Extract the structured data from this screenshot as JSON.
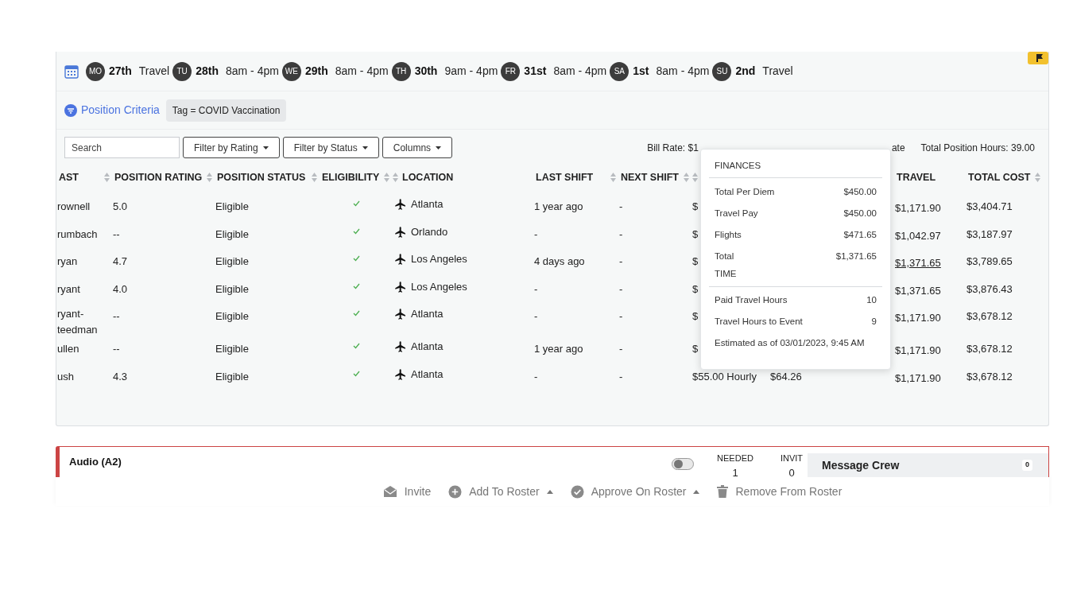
{
  "schedule": [
    {
      "day": "MO",
      "date": "27th",
      "hours": "Travel"
    },
    {
      "day": "TU",
      "date": "28th",
      "hours": "8am - 4pm"
    },
    {
      "day": "WE",
      "date": "29th",
      "hours": "8am - 4pm"
    },
    {
      "day": "TH",
      "date": "30th",
      "hours": "9am - 4pm"
    },
    {
      "day": "FR",
      "date": "31st",
      "hours": "8am - 4pm"
    },
    {
      "day": "SA",
      "date": "1st",
      "hours": "8am - 4pm"
    },
    {
      "day": "SU",
      "date": "2nd",
      "hours": "Travel"
    }
  ],
  "criteria": {
    "label": "Position Criteria",
    "tags": [
      "Tag = COVID Vaccination"
    ]
  },
  "toolbar": {
    "search_placeholder": "Search",
    "filters": [
      "Filter by Rating",
      "Filter by Status",
      "Columns"
    ],
    "bill_rate_start": "Bill Rate: $1",
    "bill_rate_end": "ate",
    "total_hours": "Total Position Hours: 39.00"
  },
  "table": {
    "columns": [
      {
        "label": "AST",
        "sortable": true
      },
      {
        "label": "POSITION RATING",
        "sortable": true
      },
      {
        "label": "POSITION STATUS",
        "sortable": true
      },
      {
        "label": "ELIGIBILITY",
        "sortable": true
      },
      {
        "label": "LOCATION",
        "sortable": true
      },
      {
        "label": "LAST SHIFT",
        "sortable": true
      },
      {
        "label": "NEXT SHIFT",
        "sortable": true
      },
      {
        "sortable": true
      },
      {
        "label": "TRAVEL",
        "sortable": false
      },
      {
        "label": "TOTAL COST",
        "sortable": true
      }
    ],
    "rows": [
      {
        "name": "rownell",
        "rating": "5.0",
        "status": "Eligible",
        "eligible": true,
        "location": "Atlanta",
        "last_shift": "1 year ago",
        "next_shift": "-",
        "column_8": "$",
        "travel": "$1,171.90",
        "travel_link": false,
        "total_cost": "$3,404.71"
      },
      {
        "name": "rumbach",
        "rating": "--",
        "status": "Eligible",
        "eligible": true,
        "location": "Orlando",
        "last_shift": "-",
        "next_shift": "-",
        "column_8": "$",
        "travel": "$1,042.97",
        "travel_link": false,
        "total_cost": "$3,187.97"
      },
      {
        "name": "ryan",
        "rating": "4.7",
        "status": "Eligible",
        "eligible": true,
        "location": "Los Angeles",
        "last_shift": "4 days ago",
        "next_shift": "-",
        "column_8": "$",
        "travel": "$1,371.65",
        "travel_link": true,
        "total_cost": "$3,789.65"
      },
      {
        "name": "ryant",
        "rating": "4.0",
        "status": "Eligible",
        "eligible": true,
        "location": "Los Angeles",
        "last_shift": "-",
        "next_shift": "-",
        "column_8": "$",
        "travel": "$1,371.65",
        "travel_link": false,
        "total_cost": "$3,876.43"
      },
      {
        "name": "ryant-teedman",
        "rating": "--",
        "status": "Eligible",
        "eligible": true,
        "location": "Atlanta",
        "last_shift": "-",
        "next_shift": "-",
        "column_8": "$",
        "travel": "$1,171.90",
        "travel_link": false,
        "total_cost": "$3,678.12"
      },
      {
        "name": "ullen",
        "rating": "--",
        "status": "Eligible",
        "eligible": true,
        "location": "Atlanta",
        "last_shift": "1 year ago",
        "next_shift": "-",
        "column_8": "$",
        "travel": "$1,171.90",
        "travel_link": false,
        "total_cost": "$3,678.12"
      },
      {
        "name": "ush",
        "rating": "4.3",
        "status": "Eligible",
        "eligible": true,
        "location": "Atlanta",
        "last_shift": "-",
        "next_shift": "-",
        "column_8": "$55.00 Hourly",
        "column_9": "$64.26",
        "travel": "$1,171.90",
        "travel_link": false,
        "total_cost": "$3,678.12"
      }
    ]
  },
  "popover": {
    "sections": [
      {
        "title": "FINANCES",
        "items": [
          {
            "label": "Total Per Diem",
            "value": "$450.00"
          },
          {
            "label": "Travel Pay",
            "value": "$450.00"
          },
          {
            "label": "Flights",
            "value": "$471.65"
          },
          {
            "label": "Total",
            "value": "$1,371.65"
          }
        ]
      },
      {
        "title": "TIME",
        "items": [
          {
            "label": "Paid Travel Hours",
            "value": "10"
          },
          {
            "label": "Travel Hours to Event",
            "value": "9"
          }
        ]
      }
    ],
    "note": "Estimated as of 03/01/2023, 9:45 AM"
  },
  "position": {
    "title": "Audio (A2)",
    "toggle_on": false,
    "stats": [
      {
        "label": "NEEDED",
        "value": "1"
      },
      {
        "label": "INVIT",
        "value": "0"
      }
    ],
    "message_crew": {
      "label": "Message Crew",
      "count": "0"
    }
  },
  "actions": [
    {
      "label": "Invite",
      "menu": false
    },
    {
      "label": "Add To Roster",
      "menu": true
    },
    {
      "label": "Approve On Roster",
      "menu": true
    },
    {
      "label": "Remove From Roster",
      "menu": false
    }
  ]
}
